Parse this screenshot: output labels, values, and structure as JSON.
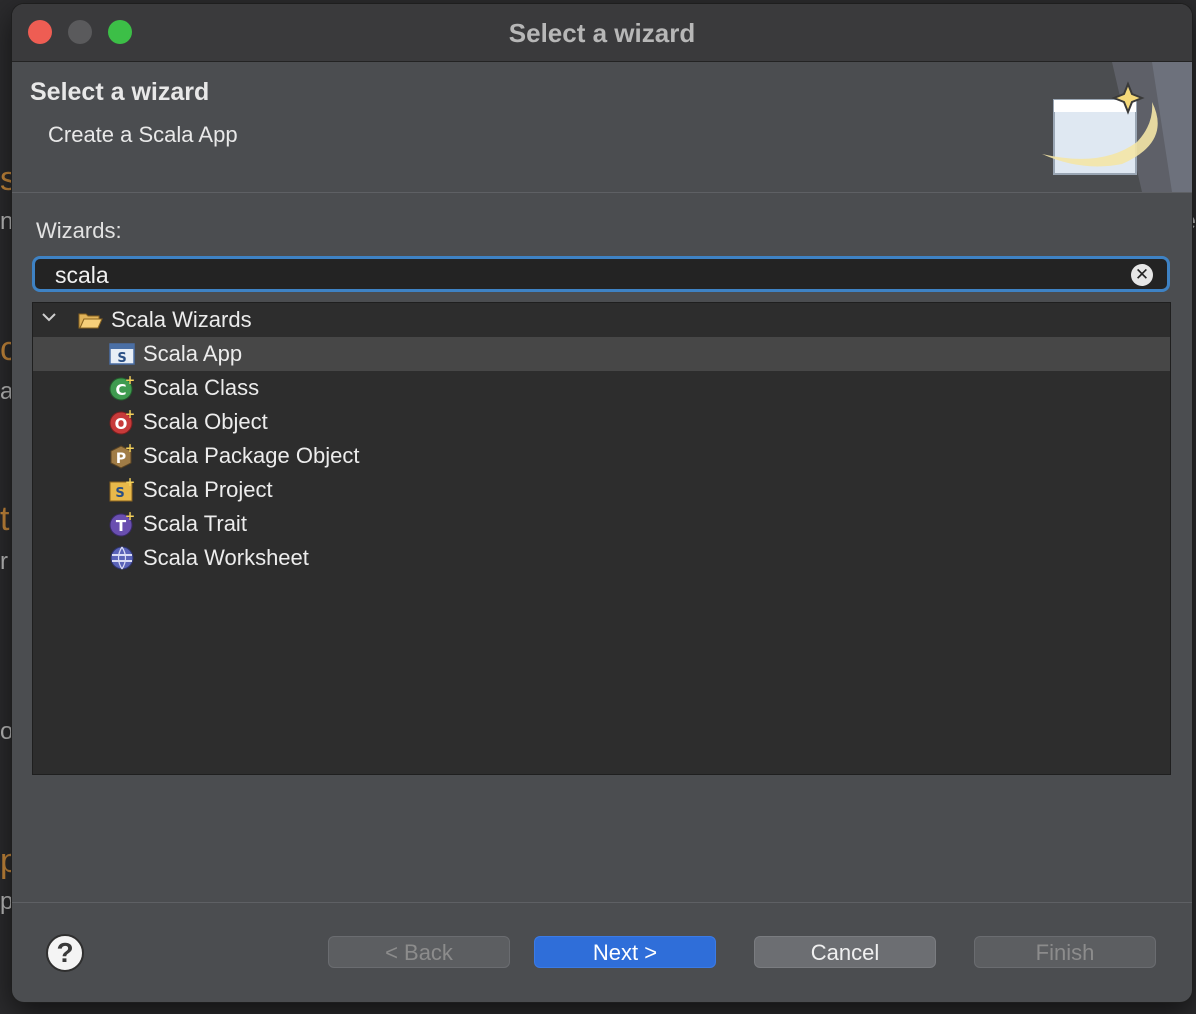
{
  "window": {
    "title": "Select a wizard"
  },
  "header": {
    "title": "Select a wizard",
    "description": "Create a Scala App"
  },
  "wizards_label": "Wizards:",
  "search": {
    "value": "scala",
    "clear_icon": "clear-circle-icon"
  },
  "tree": {
    "folder": {
      "label": "Scala Wizards",
      "expanded": true,
      "icon": "folder-open-icon"
    },
    "items": [
      {
        "label": "Scala App",
        "icon": "scala-app-icon",
        "selected": true
      },
      {
        "label": "Scala Class",
        "icon": "scala-class-icon",
        "selected": false
      },
      {
        "label": "Scala Object",
        "icon": "scala-object-icon",
        "selected": false
      },
      {
        "label": "Scala Package Object",
        "icon": "scala-package-object-icon",
        "selected": false
      },
      {
        "label": "Scala Project",
        "icon": "scala-project-icon",
        "selected": false
      },
      {
        "label": "Scala Trait",
        "icon": "scala-trait-icon",
        "selected": false
      },
      {
        "label": "Scala Worksheet",
        "icon": "scala-worksheet-icon",
        "selected": false
      }
    ]
  },
  "buttons": {
    "help_icon": "help-icon",
    "back": "< Back",
    "next": "Next >",
    "cancel": "Cancel",
    "finish": "Finish"
  },
  "colors": {
    "accent": "#2f6ed9",
    "focus_ring": "#3e82c4"
  }
}
